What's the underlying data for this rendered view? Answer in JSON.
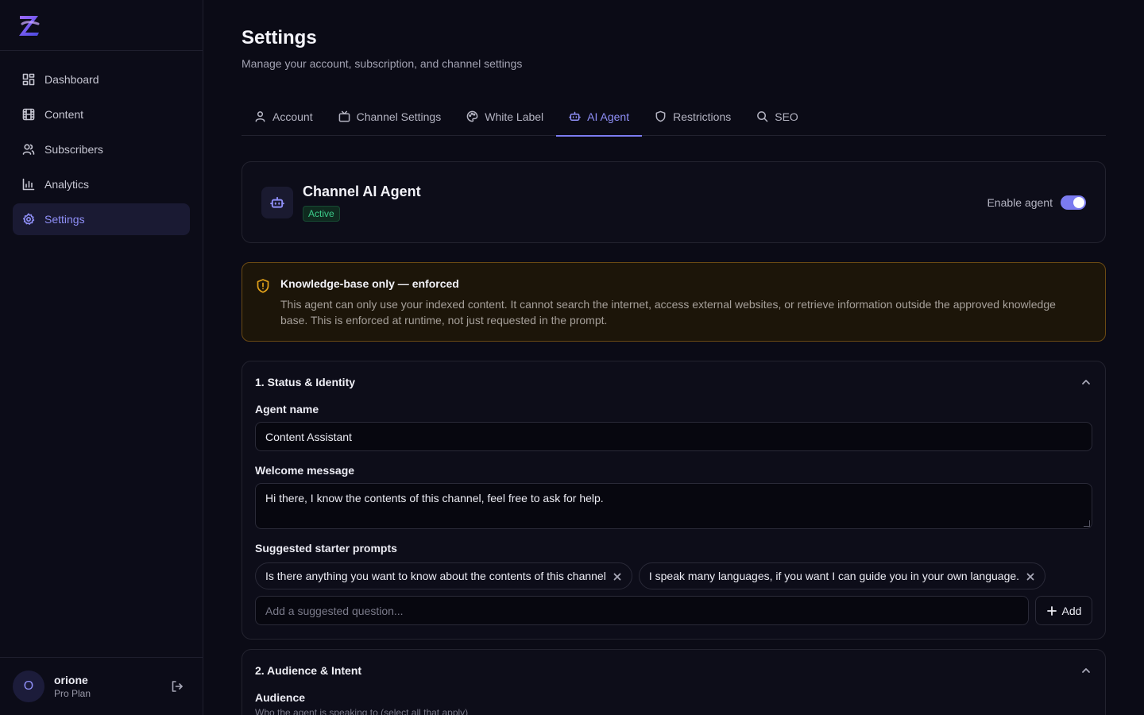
{
  "sidebar": {
    "items": [
      {
        "label": "Dashboard",
        "icon": "dashboard-icon"
      },
      {
        "label": "Content",
        "icon": "film-icon"
      },
      {
        "label": "Subscribers",
        "icon": "users-icon"
      },
      {
        "label": "Analytics",
        "icon": "bar-chart-icon"
      },
      {
        "label": "Settings",
        "icon": "gear-icon",
        "active": true
      }
    ],
    "user": {
      "initial": "O",
      "name": "orione",
      "plan": "Pro Plan"
    }
  },
  "header": {
    "title": "Settings",
    "subtitle": "Manage your account, subscription, and channel settings"
  },
  "tabs": [
    {
      "label": "Account"
    },
    {
      "label": "Channel Settings"
    },
    {
      "label": "White Label"
    },
    {
      "label": "AI Agent",
      "active": true
    },
    {
      "label": "Restrictions"
    },
    {
      "label": "SEO"
    }
  ],
  "agent": {
    "title": "Channel AI Agent",
    "status": "Active",
    "enable_label": "Enable agent",
    "enabled": true
  },
  "notice": {
    "title": "Knowledge-base only — enforced",
    "body": "This agent can only use your indexed content. It cannot search the internet, access external websites, or retrieve information outside the approved knowledge base. This is enforced at runtime, not just requested in the prompt."
  },
  "section1": {
    "title": "1. Status & Identity",
    "agent_name_label": "Agent name",
    "agent_name_value": "Content Assistant",
    "welcome_label": "Welcome message",
    "welcome_value": "Hi there, I know the contents of this channel, feel free to ask for help.",
    "prompts_label": "Suggested starter prompts",
    "prompts": [
      "Is there anything you want to know about the contents of this channel",
      "I speak many languages, if you want I can guide you in your own language."
    ],
    "add_placeholder": "Add a suggested question...",
    "add_label": "Add"
  },
  "section2": {
    "title": "2. Audience & Intent",
    "audience_label": "Audience",
    "audience_hint": "Who the agent is speaking to (select all that apply)"
  },
  "colors": {
    "accent": "#7b7bf0",
    "success": "#3ccb8a",
    "warning": "#e3a21a"
  }
}
